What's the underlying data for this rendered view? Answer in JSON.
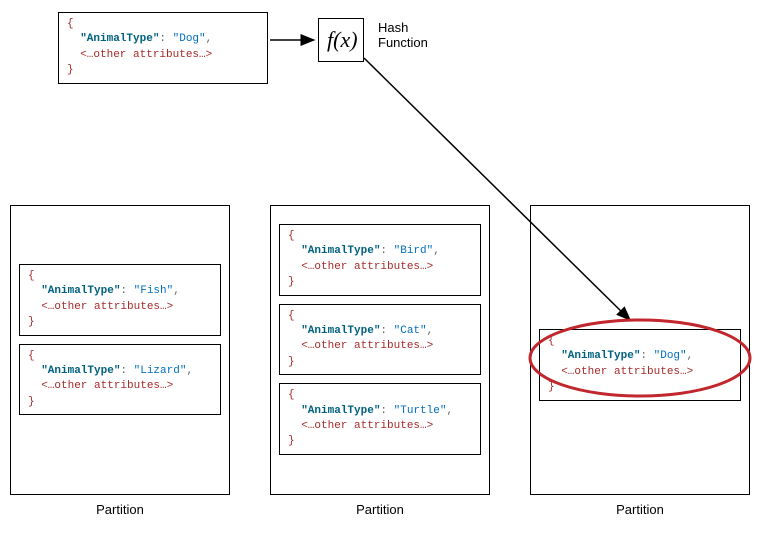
{
  "input": {
    "key_label": "\"AnimalType\"",
    "value": "\"Dog\"",
    "other": "<…other attributes…>"
  },
  "hash": {
    "symbol": "f(x)",
    "label": "Hash",
    "label2": "Function"
  },
  "partitions": [
    {
      "label": "Partition",
      "items": [
        {
          "key_label": "\"AnimalType\"",
          "value": "\"Fish\"",
          "other": "<…other attributes…>"
        },
        {
          "key_label": "\"AnimalType\"",
          "value": "\"Lizard\"",
          "other": "<…other attributes…>"
        }
      ]
    },
    {
      "label": "Partition",
      "items": [
        {
          "key_label": "\"AnimalType\"",
          "value": "\"Bird\"",
          "other": "<…other attributes…>"
        },
        {
          "key_label": "\"AnimalType\"",
          "value": "\"Cat\"",
          "other": "<…other attributes…>"
        },
        {
          "key_label": "\"AnimalType\"",
          "value": "\"Turtle\"",
          "other": "<…other attributes…>"
        }
      ]
    },
    {
      "label": "Partition",
      "items": [
        {
          "key_label": "\"AnimalType\"",
          "value": "\"Dog\"",
          "other": "<…other attributes…>"
        }
      ]
    }
  ],
  "braces": {
    "open": "{",
    "close": "}"
  }
}
